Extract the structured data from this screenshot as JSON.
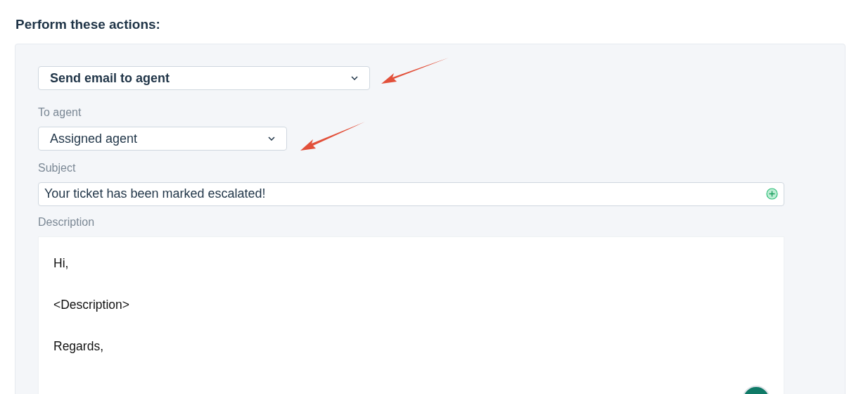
{
  "heading": "Perform these actions:",
  "action": {
    "value": "Send email to agent"
  },
  "to_agent": {
    "label": "To agent",
    "value": "Assigned agent"
  },
  "subject": {
    "label": "Subject",
    "value": "Your ticket has been marked escalated!"
  },
  "description": {
    "label": "Description",
    "lines": [
      "Hi,",
      "<Description>",
      "Regards,"
    ]
  }
}
